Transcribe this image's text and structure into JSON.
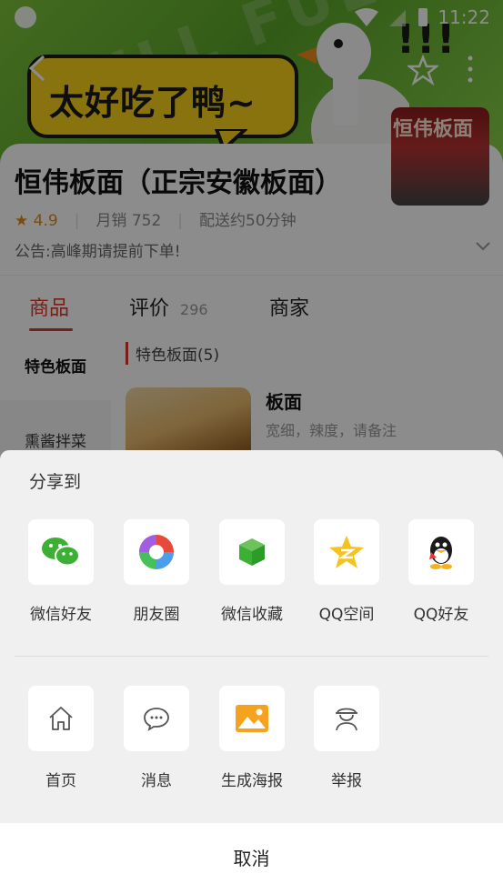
{
  "status_bar": {
    "time": "11:22"
  },
  "banner": {
    "bubble_text": "太好吃了鸭~",
    "exclaim_text": "!!!",
    "bg_watermark": "FULL FULL"
  },
  "shop": {
    "thumb_text": "恒伟板面",
    "name": "恒伟板面（正宗安徽板面）",
    "rating": "4.9",
    "monthly_sales": "月销 752",
    "delivery": "配送约50分钟",
    "notice": "公告:高峰期请提前下单!"
  },
  "tabs": [
    {
      "label": "商品",
      "count": ""
    },
    {
      "label": "评价",
      "count": "296"
    },
    {
      "label": "商家",
      "count": ""
    }
  ],
  "categories": [
    "特色板面",
    "熏酱拌菜"
  ],
  "menu": {
    "section_title": "特色板面(5)",
    "item_name": "板面",
    "item_desc": "宽细，辣度，请备注"
  },
  "share_sheet": {
    "title": "分享到",
    "row1": [
      {
        "label": "微信好友",
        "icon": "wechat-icon"
      },
      {
        "label": "朋友圈",
        "icon": "moments-icon"
      },
      {
        "label": "微信收藏",
        "icon": "wechat-favorites-icon"
      },
      {
        "label": "QQ空间",
        "icon": "qzone-icon"
      },
      {
        "label": "QQ好友",
        "icon": "qq-icon"
      }
    ],
    "row2": [
      {
        "label": "首页",
        "icon": "home-icon"
      },
      {
        "label": "消息",
        "icon": "message-icon"
      },
      {
        "label": "生成海报",
        "icon": "poster-icon"
      },
      {
        "label": "举报",
        "icon": "report-icon"
      }
    ],
    "cancel_label": "取消"
  },
  "colors": {
    "accent_red": "#d9382c",
    "rating_orange": "#e08a1e",
    "wechat_green": "#3cb034",
    "sheet_bg": "#f0f0f0"
  }
}
